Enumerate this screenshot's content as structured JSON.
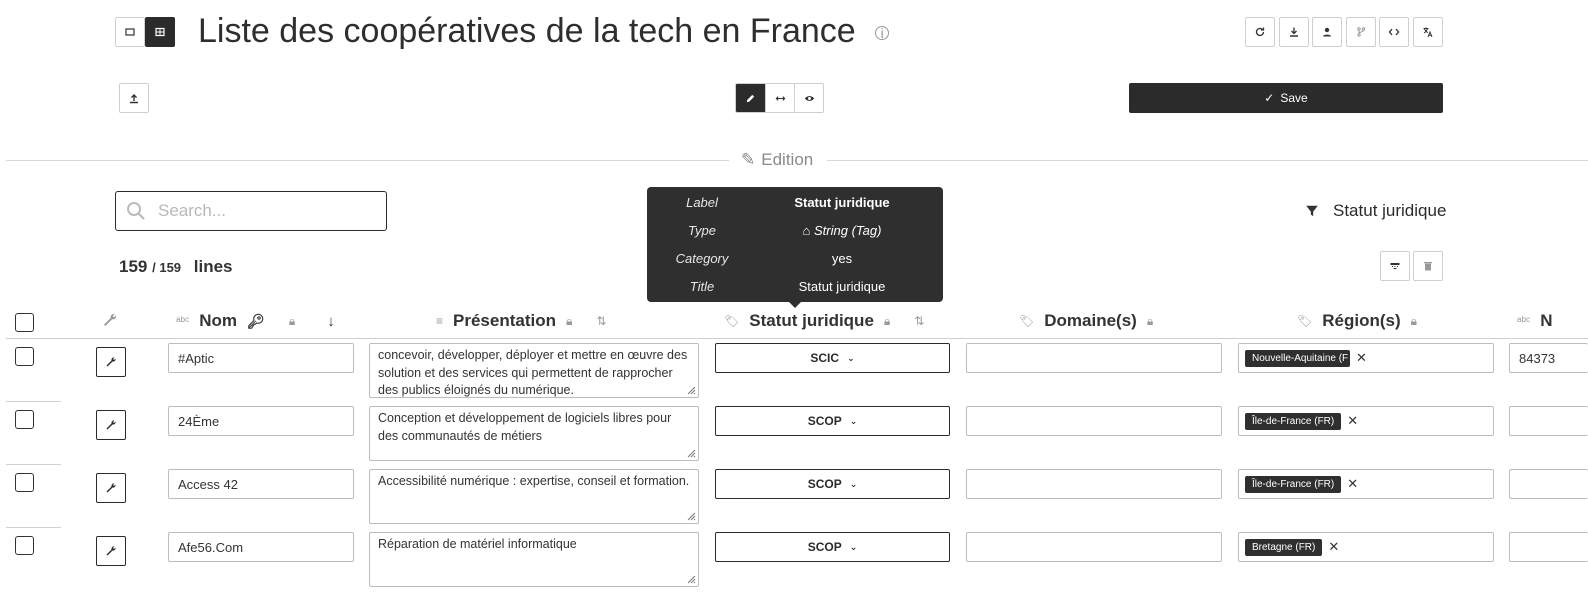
{
  "header": {
    "title": "Liste des coopératives de la tech en France",
    "save_label": "Save"
  },
  "section": {
    "label": "Edition"
  },
  "search": {
    "placeholder": "Search..."
  },
  "tooltip": {
    "rows": [
      {
        "key": "Label",
        "value": "Statut juridique"
      },
      {
        "key": "Type",
        "value": "String (Tag)"
      },
      {
        "key": "Category",
        "value": "yes"
      },
      {
        "key": "Title",
        "value": "Statut juridique"
      }
    ]
  },
  "filter": {
    "label": "Statut juridique"
  },
  "count": {
    "shown": "159",
    "total": "/ 159",
    "unit": "lines"
  },
  "columns": {
    "nom": "Nom",
    "presentation": "Présentation",
    "statut": "Statut juridique",
    "domaines": "Domaine(s)",
    "regions": "Région(s)",
    "next": "N"
  },
  "rows": [
    {
      "nom": "#Aptic",
      "presentation": "concevoir, développer, déployer et mettre en œuvre des solution et des services qui permettent de rapprocher des publics éloignés du numérique.",
      "statut": "SCIC",
      "domaines": "",
      "region": "Nouvelle-Aquitaine (F",
      "next": "84373"
    },
    {
      "nom": "24Ème",
      "presentation": "Conception et développement de logiciels libres pour des communautés de métiers",
      "statut": "SCOP",
      "domaines": "",
      "region": "Île-de-France (FR)",
      "next": ""
    },
    {
      "nom": "Access 42",
      "presentation": "Accessibilité numérique : expertise, conseil et formation.",
      "statut": "SCOP",
      "domaines": "",
      "region": "Île-de-France (FR)",
      "next": ""
    },
    {
      "nom": "Afe56.Com",
      "presentation": "Réparation de matériel informatique",
      "statut": "SCOP",
      "domaines": "",
      "region": "Bretagne (FR)",
      "next": ""
    }
  ],
  "icons": {
    "top_left": [
      "square-view-icon",
      "table-view-icon"
    ],
    "top_right": [
      "refresh-icon",
      "download-icon",
      "user-icon",
      "branch-icon",
      "code-icon",
      "translate-icon"
    ],
    "mode": [
      "pencil-icon",
      "arrows-icon",
      "eye-icon"
    ]
  }
}
